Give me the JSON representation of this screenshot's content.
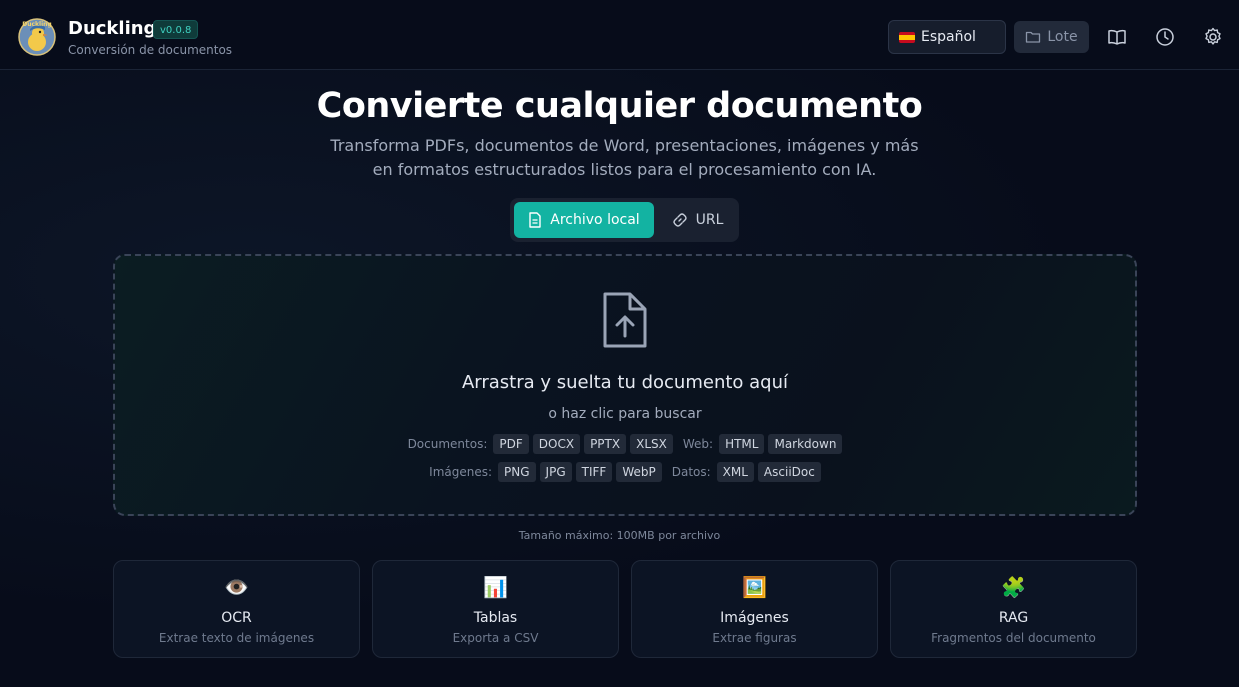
{
  "header": {
    "app_name": "Duckling",
    "version": "v0.0.8",
    "subtitle": "Conversión de documentos",
    "language": "Español",
    "batch_label": "Lote",
    "logo_text": "Duckling"
  },
  "hero": {
    "title": "Convierte cualquier documento",
    "subtitle": "Transforma PDFs, documentos de Word, presentaciones, imágenes y más en formatos estructurados listos para el procesamiento con IA."
  },
  "tabs": {
    "local": "Archivo local",
    "url": "URL"
  },
  "dropzone": {
    "title": "Arrastra y suelta tu documento aquí",
    "subtitle": "o haz clic para buscar",
    "documents_label": "Documentos:",
    "documents": [
      "PDF",
      "DOCX",
      "PPTX",
      "XLSX"
    ],
    "web_label": "Web:",
    "web": [
      "HTML",
      "Markdown"
    ],
    "images_label": "Imágenes:",
    "images": [
      "PNG",
      "JPG",
      "TIFF",
      "WebP"
    ],
    "data_label": "Datos:",
    "data": [
      "XML",
      "AsciiDoc"
    ]
  },
  "max_size": "Tamaño máximo: 100MB por archivo",
  "features": [
    {
      "icon": "👁️",
      "icon_name": "eye-icon",
      "title": "OCR",
      "desc": "Extrae texto de imágenes"
    },
    {
      "icon": "📊",
      "icon_name": "bar-chart-icon",
      "title": "Tablas",
      "desc": "Exporta a CSV"
    },
    {
      "icon": "🖼️",
      "icon_name": "framed-picture-icon",
      "title": "Imágenes",
      "desc": "Extrae figuras"
    },
    {
      "icon": "🧩",
      "icon_name": "puzzle-icon",
      "title": "RAG",
      "desc": "Fragmentos del documento"
    }
  ],
  "colors": {
    "accent": "#13b3a2",
    "background": "#070c1a"
  }
}
